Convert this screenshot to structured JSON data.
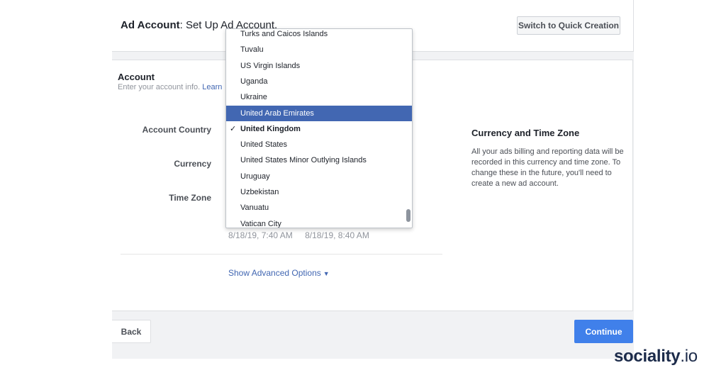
{
  "header": {
    "title_bold": "Ad Account",
    "title_rest": ": Set Up Ad Account.",
    "quick_creation_button": "Switch to Quick Creation"
  },
  "account_section": {
    "title": "Account",
    "subtitle": "Enter your account info.",
    "learn_link": "Learn"
  },
  "fields": {
    "country_label": "Account Country",
    "currency_label": "Currency",
    "timezone_label": "Time Zone"
  },
  "timezone_dates": [
    "8/18/19, 7:40 AM",
    "8/18/19, 8:40 AM"
  ],
  "advanced_options": "Show Advanced Options",
  "side_panel": {
    "title": "Currency and Time Zone",
    "text": "All your ads billing and reporting data will be recorded in this currency and time zone. To change these in the future, you'll need to create a new ad account."
  },
  "country_dropdown": {
    "items": [
      "Turks and Caicos Islands",
      "Tuvalu",
      "US Virgin Islands",
      "Uganda",
      "Ukraine",
      "United Arab Emirates",
      "United Kingdom",
      "United States",
      "United States Minor Outlying Islands",
      "Uruguay",
      "Uzbekistan",
      "Vanuatu",
      "Vatican City"
    ],
    "highlighted": "United Arab Emirates",
    "selected": "United Kingdom",
    "check_glyph": "✓"
  },
  "footer": {
    "back_button": "Back",
    "continue_button": "Continue"
  },
  "brand": {
    "name": "sociality",
    "tld": ".io"
  },
  "colors": {
    "accent": "#4267b2",
    "continue": "#4080ea",
    "brand": "#1c2b4a"
  }
}
